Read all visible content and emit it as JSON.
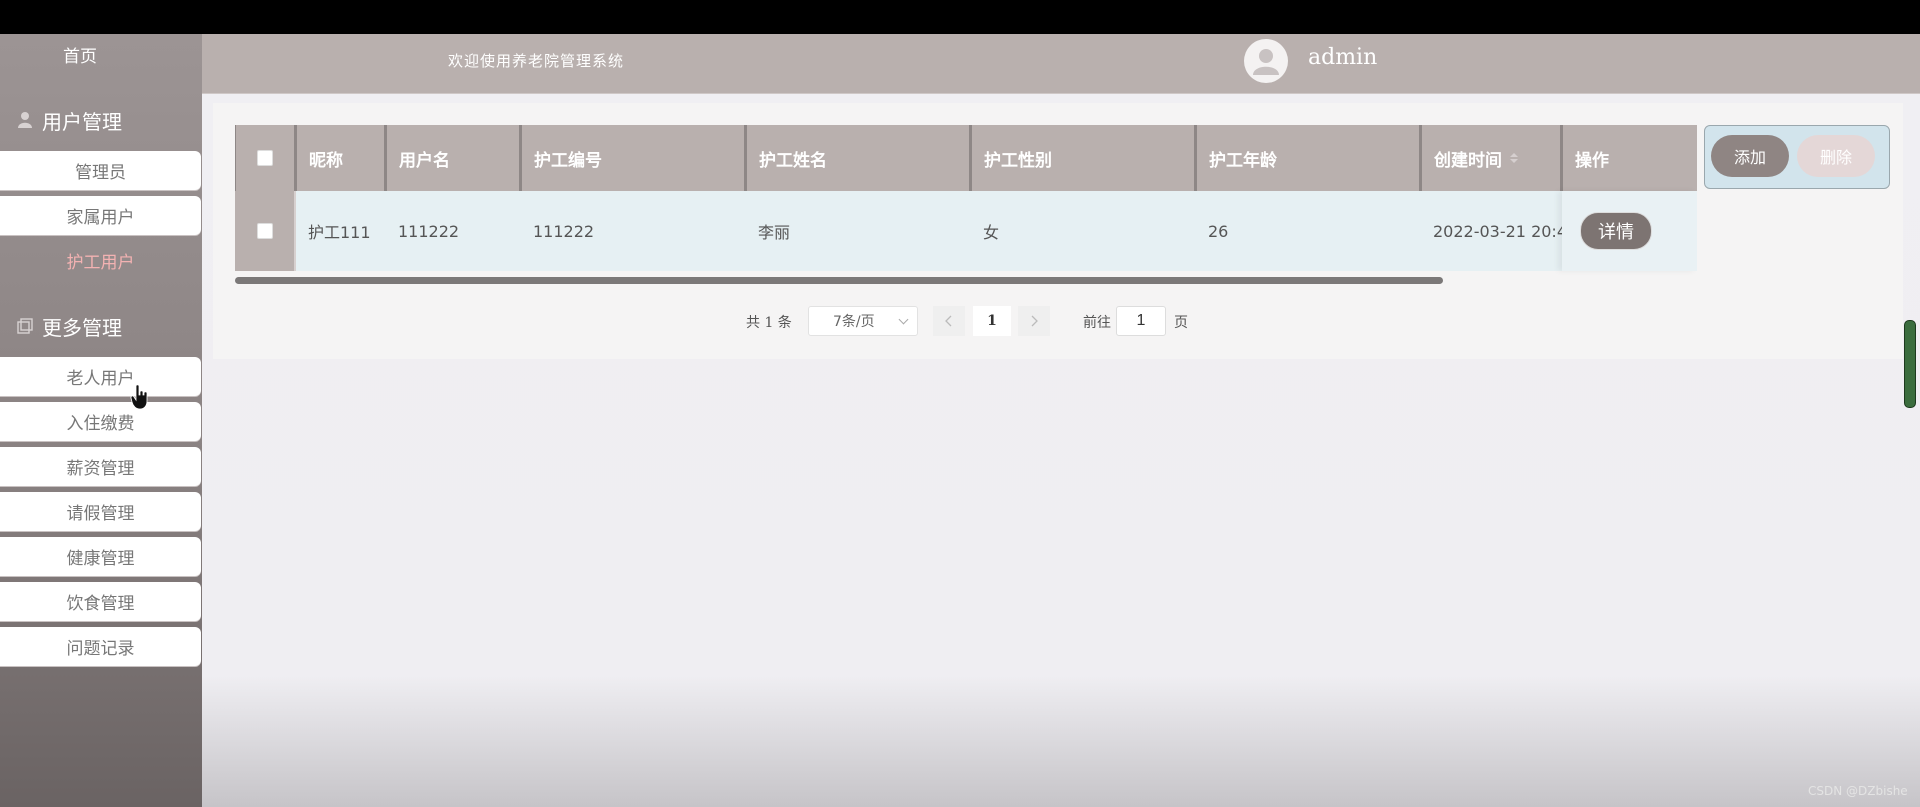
{
  "header": {
    "welcome": "欢迎使用养老院管理系统",
    "username": "admin"
  },
  "sidebar": {
    "home": "首页",
    "sections": [
      {
        "title": "用户管理",
        "items": [
          {
            "label": "管理员"
          },
          {
            "label": "家属用户"
          },
          {
            "label": "护工用户",
            "active": true
          }
        ]
      },
      {
        "title": "更多管理",
        "items": [
          {
            "label": "老人用户"
          },
          {
            "label": "入住缴费"
          },
          {
            "label": "薪资管理"
          },
          {
            "label": "请假管理"
          },
          {
            "label": "健康管理"
          },
          {
            "label": "饮食管理"
          },
          {
            "label": "问题记录"
          }
        ]
      }
    ]
  },
  "table": {
    "columns": [
      "昵称",
      "用户名",
      "护工编号",
      "护工姓名",
      "护工性别",
      "护工年龄",
      "创建时间",
      "操作"
    ],
    "rows": [
      {
        "nickname": "护工111",
        "username": "111222",
        "worker_no": "111222",
        "worker_name": "李丽",
        "gender": "女",
        "age": "26",
        "created": "2022-03-21 20:4",
        "action": "详情"
      }
    ]
  },
  "actions": {
    "add": "添加",
    "delete": "删除"
  },
  "pagination": {
    "total": "共 1 条",
    "page_size": "7条/页",
    "current": "1",
    "goto_label": "前往",
    "goto_value": "1",
    "page_label": "页"
  },
  "watermark": "CSDN @DZbishe",
  "colors": {
    "header_bg": "#b9b0ae",
    "table_header": "#b9b0ae",
    "row_bg": "#e6f0f3",
    "accent_active": "#f3b2b2",
    "button_dark": "#7d7472"
  }
}
